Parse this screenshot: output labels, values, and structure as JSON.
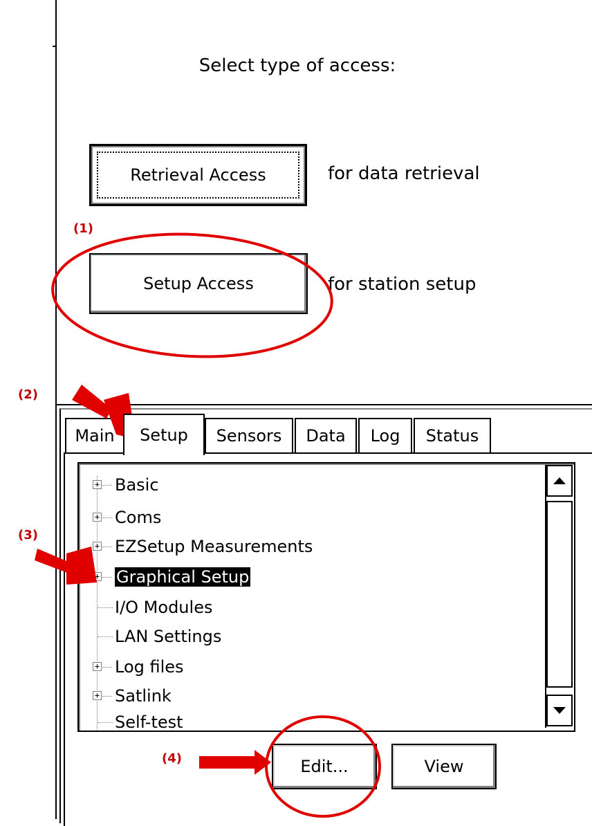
{
  "access": {
    "title": "Select type of access:",
    "retrieval_button": "Retrieval Access",
    "retrieval_desc": "for data retrieval",
    "setup_button": "Setup Access",
    "setup_desc": "for station setup"
  },
  "tabs": [
    {
      "label": "Main"
    },
    {
      "label": "Setup"
    },
    {
      "label": "Sensors"
    },
    {
      "label": "Data"
    },
    {
      "label": "Log"
    },
    {
      "label": "Status"
    }
  ],
  "active_tab": "Setup",
  "tree": {
    "items": [
      {
        "label": "Basic",
        "expandable": true
      },
      {
        "label": "Coms",
        "expandable": true
      },
      {
        "label": "EZSetup Measurements",
        "expandable": true
      },
      {
        "label": "Graphical Setup",
        "expandable": true,
        "selected": true
      },
      {
        "label": "I/O Modules",
        "expandable": false
      },
      {
        "label": "LAN Settings",
        "expandable": false
      },
      {
        "label": "Log files",
        "expandable": true
      },
      {
        "label": "Satlink",
        "expandable": true
      },
      {
        "label": "Self-test",
        "expandable": false
      }
    ]
  },
  "buttons": {
    "edit": "Edit...",
    "view": "View"
  },
  "annotations": {
    "step1": "(1)",
    "step2": "(2)",
    "step3": "(3)",
    "step4": "(4)",
    "color": "#e00000"
  },
  "icons": {
    "scroll_up": "triangle-up-icon",
    "scroll_down": "triangle-down-icon",
    "expander": "plus-box-icon"
  }
}
